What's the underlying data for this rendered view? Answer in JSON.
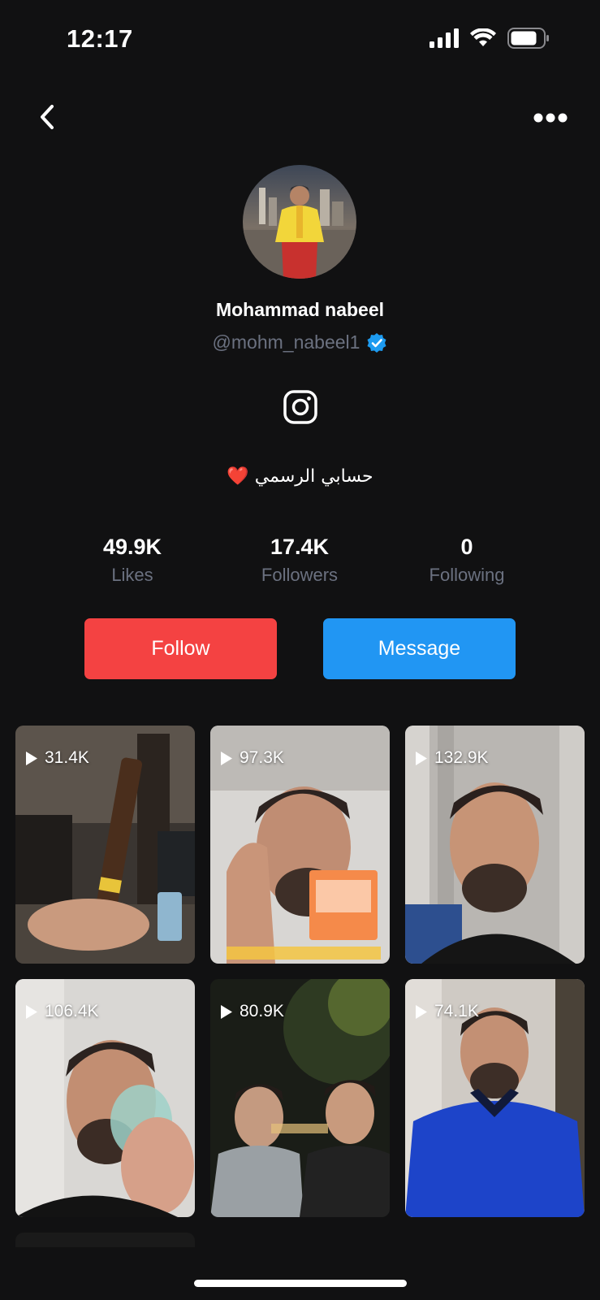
{
  "status": {
    "time": "12:17",
    "battery_icon": "battery-icon",
    "wifi_icon": "wifi-icon",
    "signal_icon": "signal-icon"
  },
  "nav": {
    "back_icon": "chevron-left-icon",
    "more_icon": "more-dots-icon"
  },
  "profile": {
    "display_name": "Mohammad nabeel",
    "handle": "@mohm_nabeel1",
    "verified_icon": "verified-badge-icon",
    "social_icon": "instagram-icon",
    "bio": "❤️ حسابي الرسمي"
  },
  "stats": [
    {
      "value": "49.9K",
      "label": "Likes"
    },
    {
      "value": "17.4K",
      "label": "Followers"
    },
    {
      "value": "0",
      "label": "Following"
    }
  ],
  "actions": {
    "follow_label": "Follow",
    "message_label": "Message"
  },
  "videos": [
    {
      "views": "31.4K"
    },
    {
      "views": "97.3K"
    },
    {
      "views": "132.9K"
    },
    {
      "views": "106.4K"
    },
    {
      "views": "80.9K"
    },
    {
      "views": "74.1K"
    }
  ],
  "colors": {
    "background": "#111112",
    "follow": "#f44242",
    "message": "#2196f3",
    "muted_text": "#6b7180",
    "verified": "#1d9bf0"
  }
}
